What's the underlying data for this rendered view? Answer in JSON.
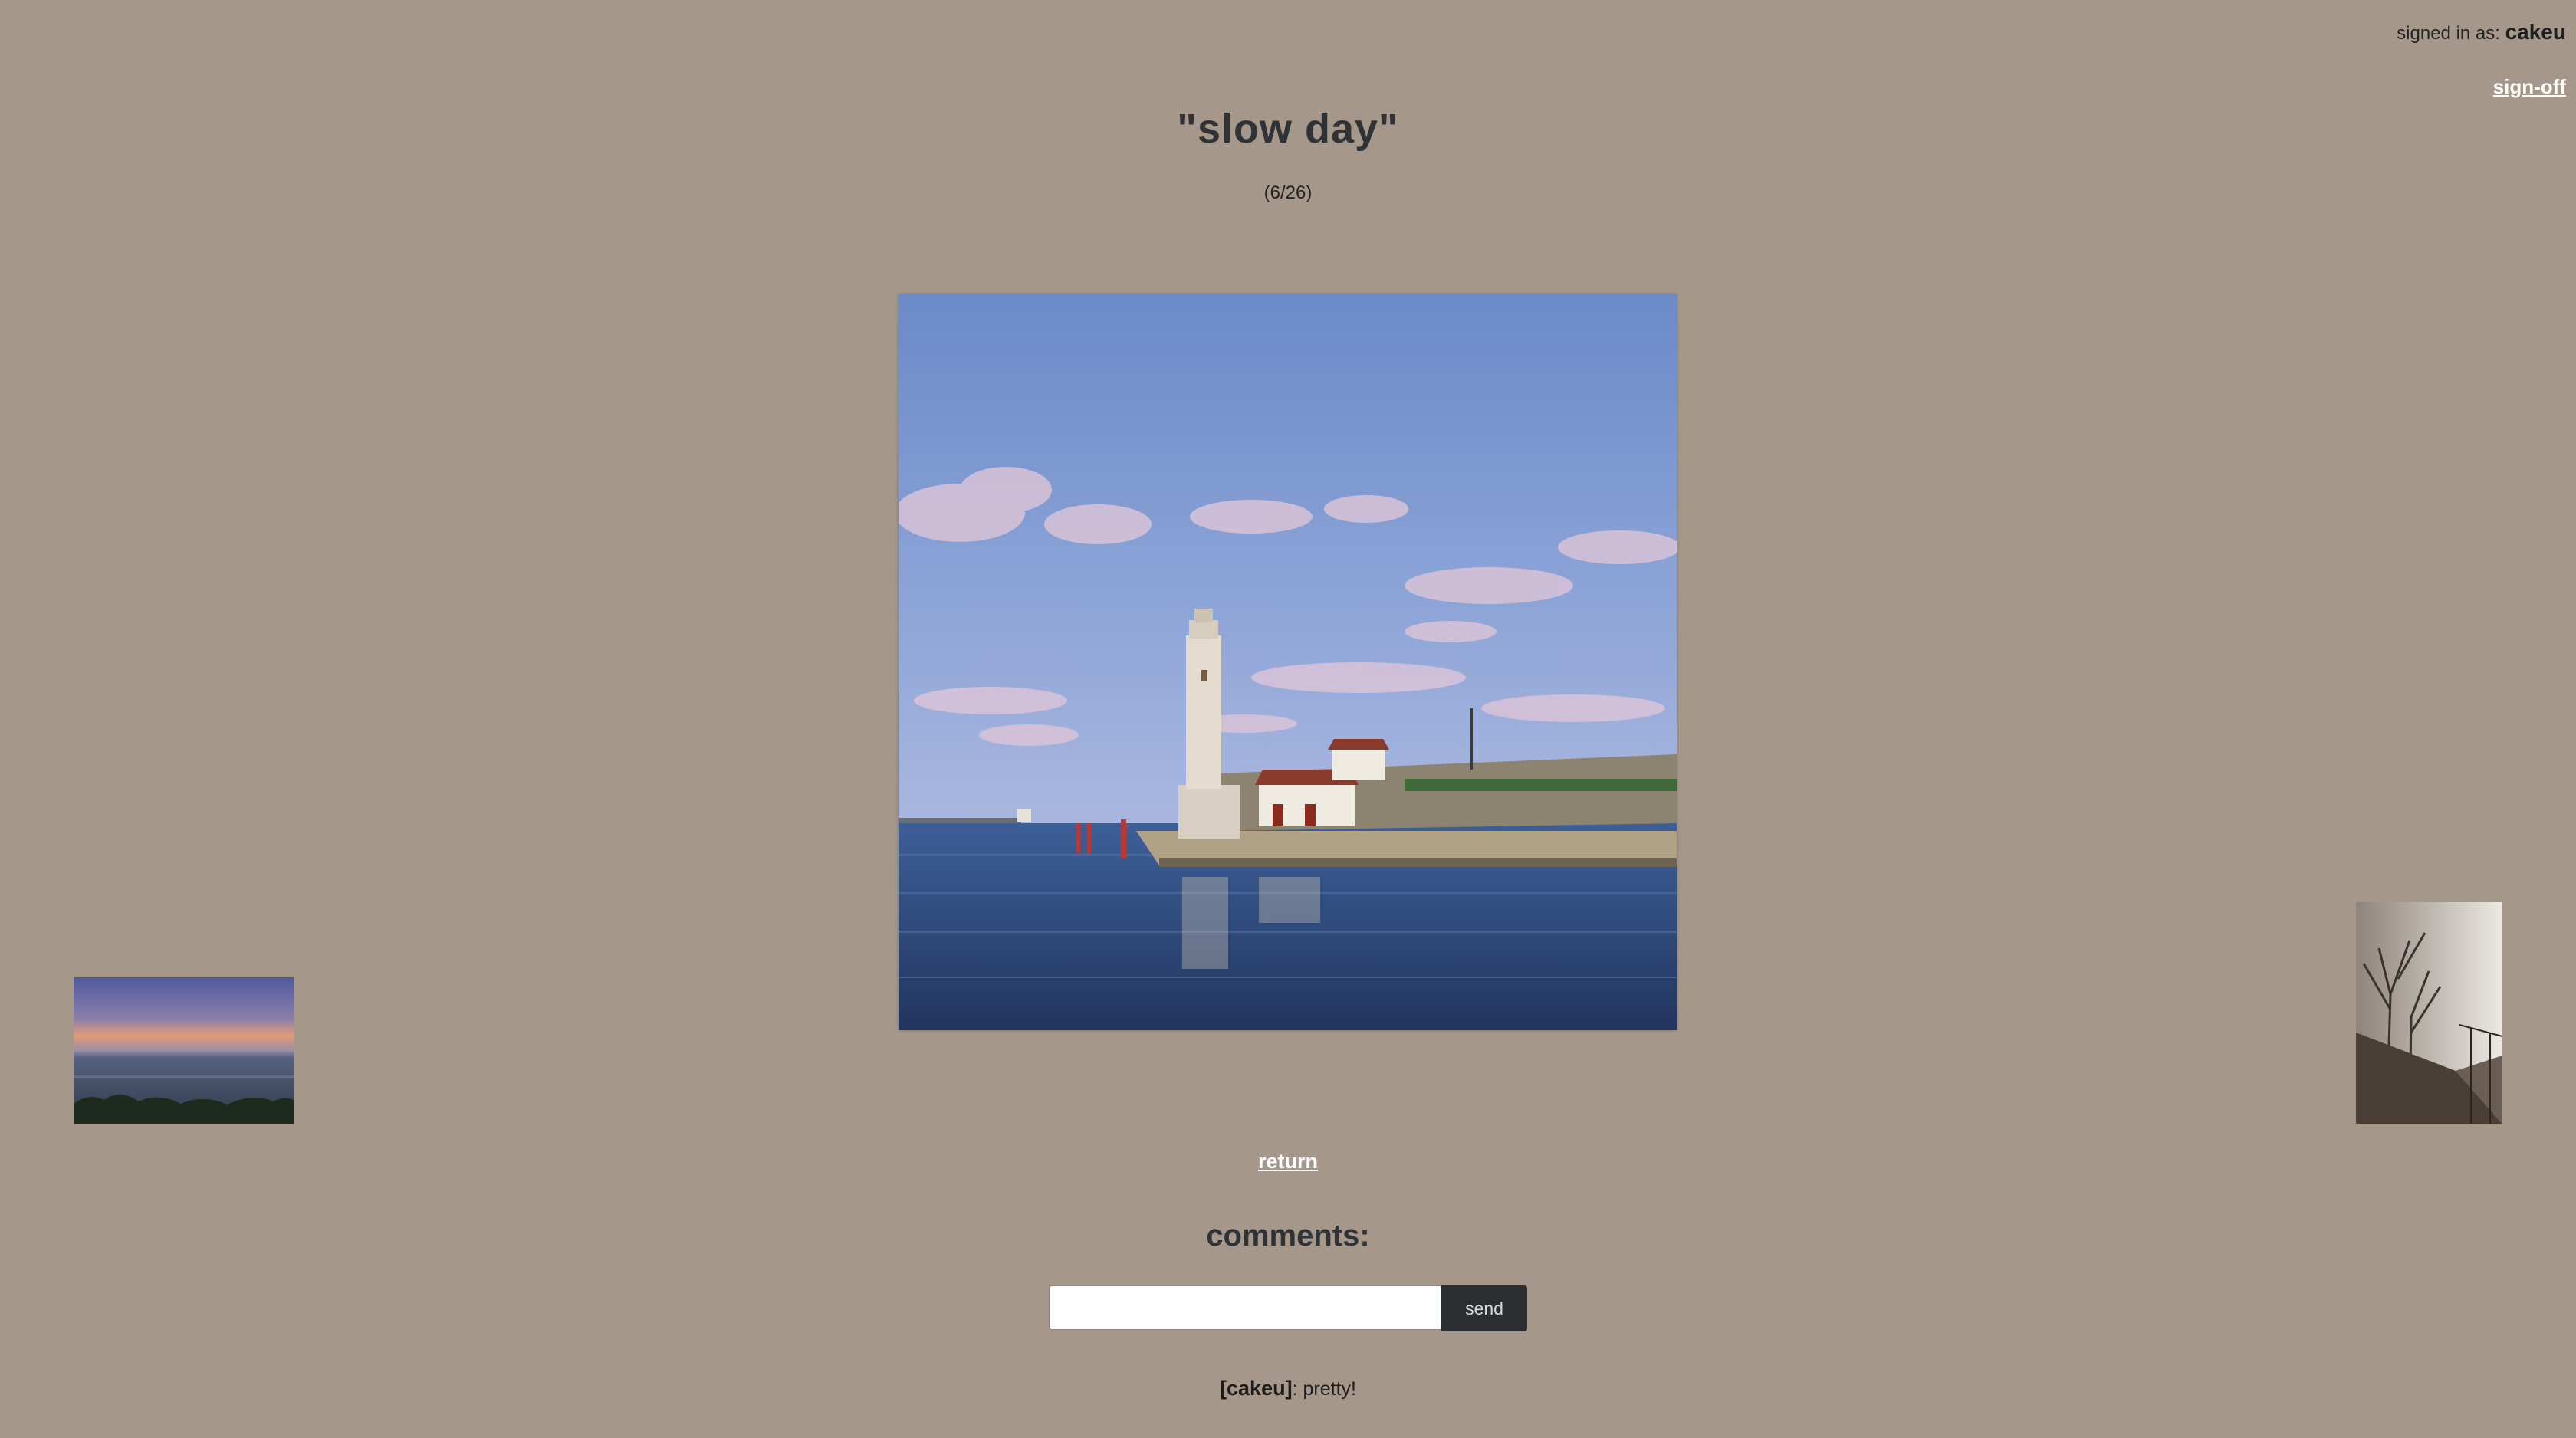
{
  "user": {
    "signed_in_label": "signed in as: ",
    "username": "cakeu",
    "signoff_label": "sign-off"
  },
  "photo": {
    "title": "\"slow day\"",
    "counter": "(6/26)",
    "alt": "lighthouse on harbour pier under blue sky"
  },
  "navigation": {
    "return_label": "return"
  },
  "comments": {
    "heading": "comments:",
    "input_value": "",
    "send_label": "send",
    "items": [
      {
        "author": "[cakeu]",
        "separator": ": ",
        "text": "pretty!"
      }
    ]
  },
  "colors": {
    "background": "#a59789",
    "title": "#2f3336",
    "link": "#ffffff",
    "button": "#2b2e31"
  }
}
